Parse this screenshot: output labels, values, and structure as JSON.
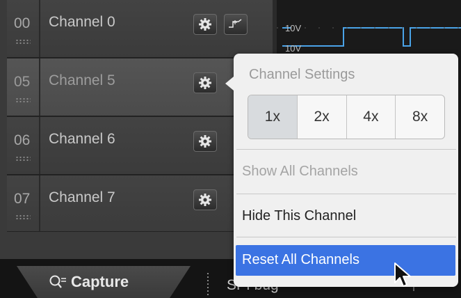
{
  "channels": [
    {
      "num": "00",
      "name": "Channel 0"
    },
    {
      "num": "05",
      "name": "Channel 5"
    },
    {
      "num": "06",
      "name": "Channel 6"
    },
    {
      "num": "07",
      "name": "Channel 7"
    }
  ],
  "waveform": {
    "label_top": "10V",
    "label_second": "10V"
  },
  "popup": {
    "title": "Channel Settings",
    "scale_options": [
      "1x",
      "2x",
      "4x",
      "8x"
    ],
    "selected_scale": "1x",
    "show_all": "Show All Channels",
    "hide_this": "Hide This Channel",
    "reset_all": "Reset All Channels"
  },
  "tabs": {
    "capture": "Capture",
    "spi": "SPI bug"
  },
  "colors": {
    "highlight": "#3b73e3",
    "waveform": "#4aa3e8"
  },
  "icons": [
    "gear-icon",
    "trigger-icon",
    "search-icon",
    "pin-icon",
    "cursor-icon"
  ]
}
